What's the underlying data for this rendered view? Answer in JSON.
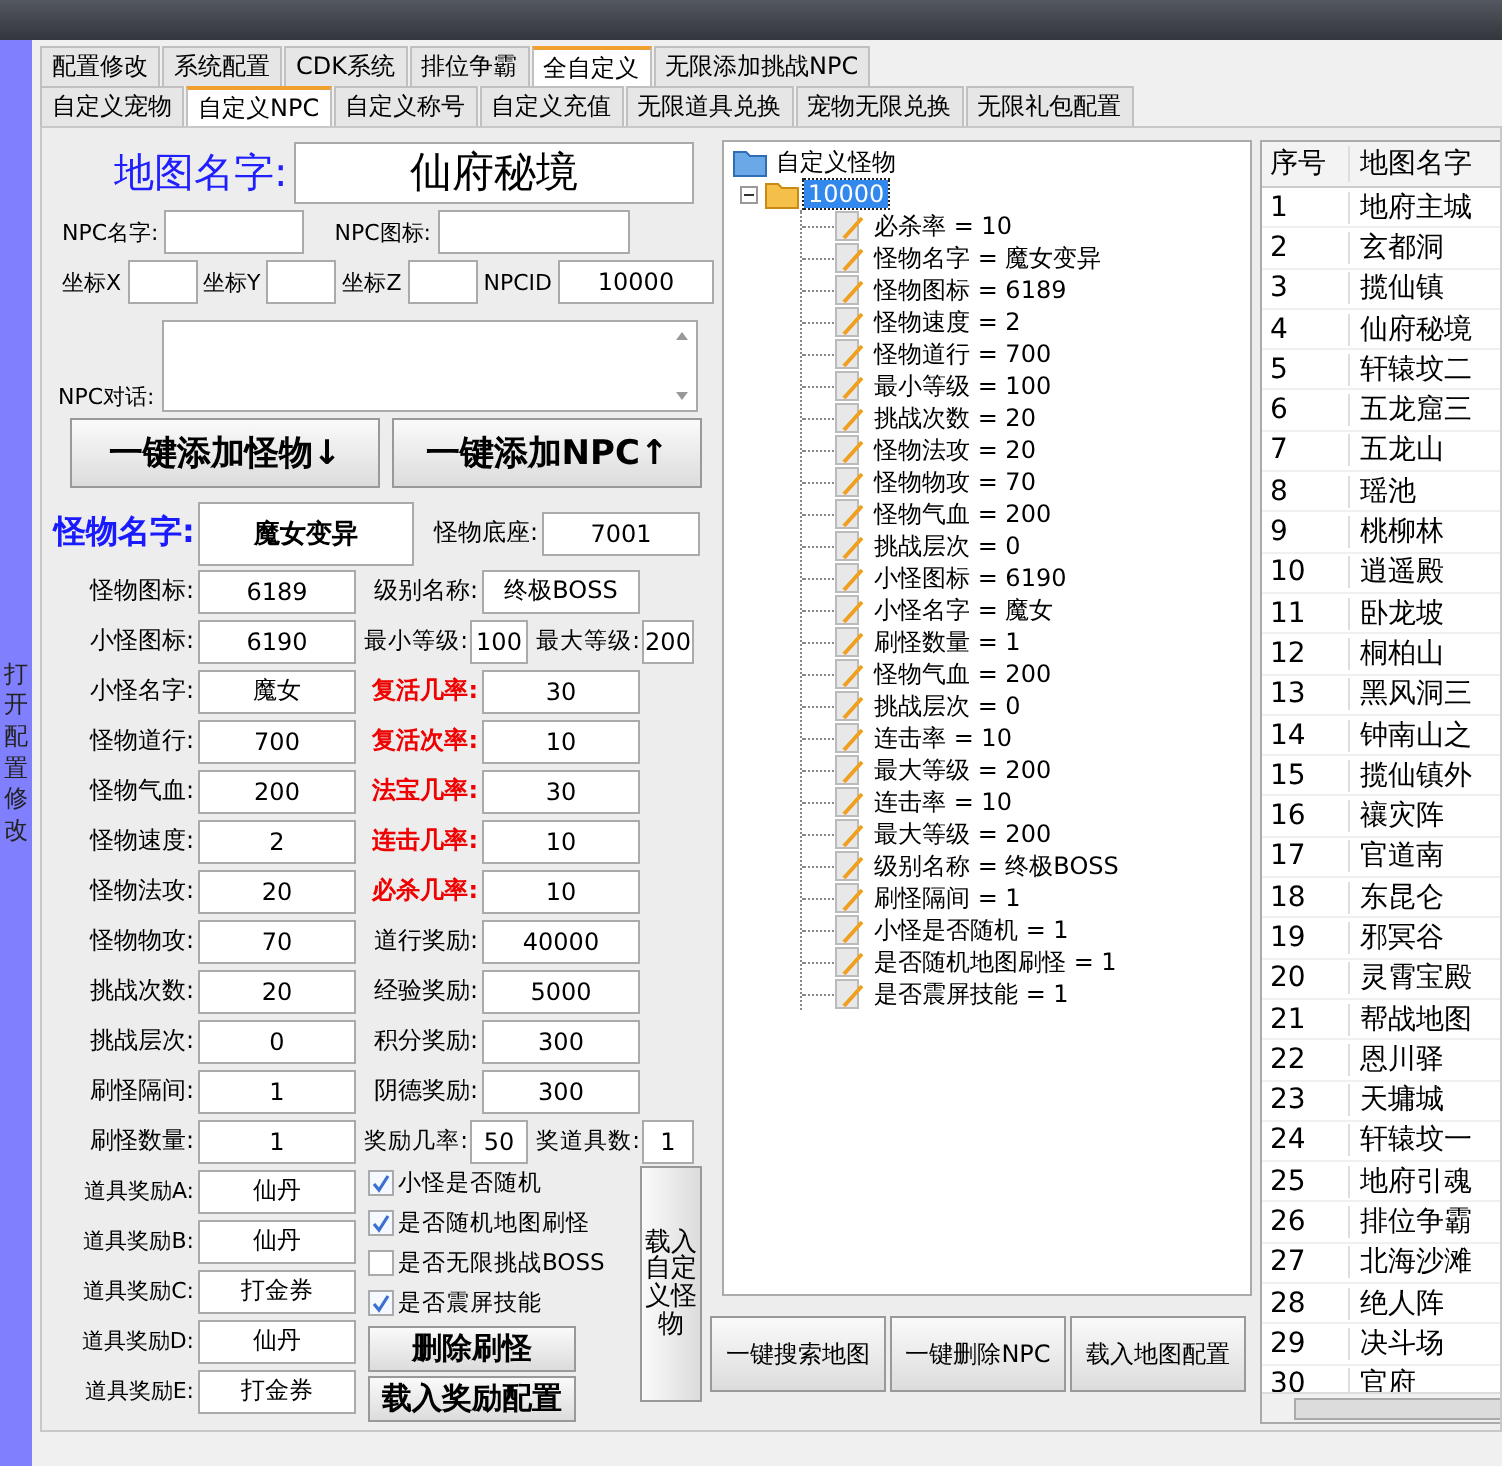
{
  "side_strip": {
    "label": "打开配置修改"
  },
  "tabs_primary": [
    {
      "label": "配置修改",
      "selected": false
    },
    {
      "label": "系统配置",
      "selected": false
    },
    {
      "label": "CDK系统",
      "selected": false
    },
    {
      "label": "排位争霸",
      "selected": false
    },
    {
      "label": "全自定义",
      "selected": true
    },
    {
      "label": "无限添加挑战NPC",
      "selected": false
    }
  ],
  "tabs_secondary": [
    {
      "label": "自定义宠物",
      "selected": false
    },
    {
      "label": "自定义NPC",
      "selected": true
    },
    {
      "label": "自定义称号",
      "selected": false
    },
    {
      "label": "自定义充值",
      "selected": false
    },
    {
      "label": "无限道具兑换",
      "selected": false
    },
    {
      "label": "宠物无限兑换",
      "selected": false
    },
    {
      "label": "无限礼包配置",
      "selected": false
    }
  ],
  "map_name": {
    "label": "地图名字:",
    "value": "仙府秘境"
  },
  "npc_fields": [
    {
      "label": "NPC名字:"
    },
    {
      "label": "NPC图标:"
    }
  ],
  "coords": [
    {
      "label": "坐标X"
    },
    {
      "label": "坐标Y"
    },
    {
      "label": "坐标Z"
    },
    {
      "label": "NPCID",
      "value": "10000"
    }
  ],
  "npc_dialog": {
    "label": "NPC对话:"
  },
  "add_buttons": [
    "一键添加怪物↓",
    "一键添加NPC↑"
  ],
  "monster_name": {
    "label": "怪物名字:",
    "value": "魔女变异",
    "right": {
      "label": "怪物底座:",
      "value": "7001"
    }
  },
  "form_rows": [
    {
      "left": {
        "label": "怪物图标:",
        "value": "6189"
      },
      "kind": "single",
      "right": [
        {
          "label": "级别名称:",
          "value": "终极BOSS",
          "highlight": false
        }
      ]
    },
    {
      "left": {
        "label": "小怪图标:",
        "value": "6190"
      },
      "kind": "pair",
      "right": [
        {
          "label": "最小等级:",
          "value": "100",
          "highlight": false
        },
        {
          "label": "最大等级:",
          "value": "200",
          "highlight": false
        }
      ]
    },
    {
      "left": {
        "label": "小怪名字:",
        "value": "魔女"
      },
      "kind": "single",
      "right": [
        {
          "label": "复活几率:",
          "value": "30",
          "highlight": true
        }
      ]
    },
    {
      "left": {
        "label": "怪物道行:",
        "value": "700"
      },
      "kind": "single",
      "right": [
        {
          "label": "复活次率:",
          "value": "10",
          "highlight": true
        }
      ]
    },
    {
      "left": {
        "label": "怪物气血:",
        "value": "200"
      },
      "kind": "single",
      "right": [
        {
          "label": "法宝几率:",
          "value": "30",
          "highlight": true
        }
      ]
    },
    {
      "left": {
        "label": "怪物速度:",
        "value": "2"
      },
      "kind": "single",
      "right": [
        {
          "label": "连击几率:",
          "value": "10",
          "highlight": true
        }
      ]
    },
    {
      "left": {
        "label": "怪物法攻:",
        "value": "20"
      },
      "kind": "single",
      "right": [
        {
          "label": "必杀几率:",
          "value": "10",
          "highlight": true
        }
      ]
    },
    {
      "left": {
        "label": "怪物物攻:",
        "value": "70"
      },
      "kind": "single",
      "right": [
        {
          "label": "道行奖励:",
          "value": "40000",
          "highlight": false
        }
      ]
    },
    {
      "left": {
        "label": "挑战次数:",
        "value": "20"
      },
      "kind": "single",
      "right": [
        {
          "label": "经验奖励:",
          "value": "5000",
          "highlight": false
        }
      ]
    },
    {
      "left": {
        "label": "挑战层次:",
        "value": "0"
      },
      "kind": "single",
      "right": [
        {
          "label": "积分奖励:",
          "value": "300",
          "highlight": false
        }
      ]
    },
    {
      "left": {
        "label": "刷怪隔间:",
        "value": "1"
      },
      "kind": "single",
      "right": [
        {
          "label": "阴德奖励:",
          "value": "300",
          "highlight": false
        }
      ]
    },
    {
      "left": {
        "label": "刷怪数量:",
        "value": "1"
      },
      "kind": "pair",
      "right": [
        {
          "label": "奖励几率:",
          "value": "50",
          "highlight": false
        },
        {
          "label": "奖道具数:",
          "value": "1",
          "highlight": false
        }
      ]
    }
  ],
  "item_rewards": [
    {
      "label": "道具奖励A:",
      "value": "仙丹"
    },
    {
      "label": "道具奖励B:",
      "value": "仙丹"
    },
    {
      "label": "道具奖励C:",
      "value": "打金券"
    },
    {
      "label": "道具奖励D:",
      "value": "仙丹"
    },
    {
      "label": "道具奖励E:",
      "value": "打金券"
    }
  ],
  "options": [
    {
      "label": "小怪是否随机",
      "checked": true
    },
    {
      "label": "是否随机地图刷怪",
      "checked": true
    },
    {
      "label": "是否无限挑战BOSS",
      "checked": false
    },
    {
      "label": "是否震屏技能",
      "checked": true
    }
  ],
  "action_buttons": [
    "删除刷怪",
    "载入奖励配置"
  ],
  "load_monster_button": "载入自定义怪物",
  "tree": {
    "label": "自定义怪物",
    "children": [
      {
        "label": "10000",
        "expanded": true,
        "selected": true,
        "children": [
          {
            "label": "必杀率 = 10"
          },
          {
            "label": "怪物名字 = 魔女变异"
          },
          {
            "label": "怪物图标 = 6189"
          },
          {
            "label": "怪物速度 = 2"
          },
          {
            "label": "怪物道行 = 700"
          },
          {
            "label": "最小等级 = 100"
          },
          {
            "label": "挑战次数 = 20"
          },
          {
            "label": "怪物法攻 = 20"
          },
          {
            "label": "怪物物攻 = 70"
          },
          {
            "label": "怪物气血 = 200"
          },
          {
            "label": "挑战层次 = 0"
          },
          {
            "label": "小怪图标 = 6190"
          },
          {
            "label": "小怪名字 = 魔女"
          },
          {
            "label": "刷怪数量 = 1"
          },
          {
            "label": "怪物气血 = 200"
          },
          {
            "label": "挑战层次 = 0"
          },
          {
            "label": "连击率 = 10"
          },
          {
            "label": "最大等级 = 200"
          },
          {
            "label": "连击率 = 10"
          },
          {
            "label": "最大等级 = 200"
          },
          {
            "label": "级别名称 = 终极BOSS"
          },
          {
            "label": "刷怪隔间 = 1"
          },
          {
            "label": "小怪是否随机 = 1"
          },
          {
            "label": "是否随机地图刷怪 = 1"
          },
          {
            "label": "是否震屏技能 = 1"
          }
        ]
      }
    ]
  },
  "map_buttons": [
    "一键搜索地图",
    "一键删除NPC",
    "载入地图配置"
  ],
  "map_table": {
    "columns": [
      "序号",
      "地图名字"
    ],
    "rows": [
      [
        "1",
        "地府主城"
      ],
      [
        "2",
        "玄都洞"
      ],
      [
        "3",
        "揽仙镇"
      ],
      [
        "4",
        "仙府秘境"
      ],
      [
        "5",
        "轩辕坟二"
      ],
      [
        "6",
        "五龙窟三"
      ],
      [
        "7",
        "五龙山"
      ],
      [
        "8",
        "瑶池"
      ],
      [
        "9",
        "桃柳林"
      ],
      [
        "10",
        "逍遥殿"
      ],
      [
        "11",
        "卧龙坡"
      ],
      [
        "12",
        "桐柏山"
      ],
      [
        "13",
        "黑风洞三"
      ],
      [
        "14",
        "钟南山之"
      ],
      [
        "15",
        "揽仙镇外"
      ],
      [
        "16",
        "禳灾阵"
      ],
      [
        "17",
        "官道南"
      ],
      [
        "18",
        "东昆仑"
      ],
      [
        "19",
        "邪冥谷"
      ],
      [
        "20",
        "灵霄宝殿"
      ],
      [
        "21",
        "帮战地图"
      ],
      [
        "22",
        "恩川驿"
      ],
      [
        "23",
        "天墉城"
      ],
      [
        "24",
        "轩辕坟一"
      ],
      [
        "25",
        "地府引魂"
      ],
      [
        "26",
        "排位争霸"
      ],
      [
        "27",
        "北海沙滩"
      ],
      [
        "28",
        "绝人阵"
      ],
      [
        "29",
        "决斗场"
      ],
      [
        "30",
        "官府"
      ]
    ]
  }
}
